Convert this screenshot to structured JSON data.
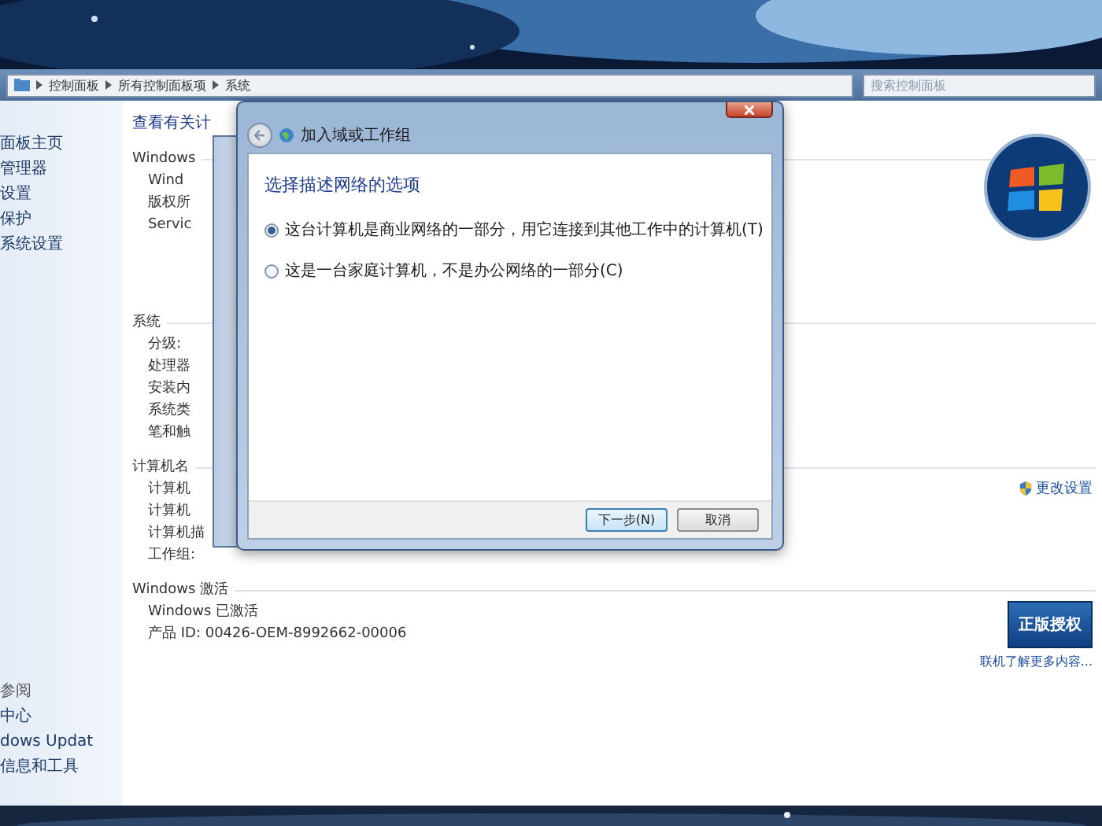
{
  "address_bar": {
    "breadcrumb": [
      "控制面板",
      "所有控制面板项",
      "系统"
    ],
    "search": {
      "placeholder": "搜索控制面板"
    }
  },
  "sidebar": {
    "links": [
      "面板主页",
      "管理器",
      "设置",
      "保护",
      "系统设置"
    ],
    "see_also": [
      "参阅",
      "中心",
      "dows Updat",
      "信息和工具"
    ]
  },
  "content": {
    "title": "查看有关计",
    "sections": [
      {
        "heading": "Windows",
        "rows": [
          "Wind",
          "版权所",
          "Servic"
        ],
        "kind": "logo"
      },
      {
        "heading": "系统",
        "rows": [
          "分级:",
          "处理器",
          "安装内",
          "系统类",
          "笔和触"
        ]
      },
      {
        "heading": "计算机名",
        "rows": [
          "计算机",
          "计算机",
          "计算机描",
          "工作组:"
        ],
        "kind": "settings"
      },
      {
        "heading": "Windows 激活",
        "rows": [
          "Windows 已激活",
          "产品 ID: 00426-OEM-8992662-00006"
        ],
        "kind": "activation"
      }
    ],
    "change_settings": "更改设置",
    "activation": {
      "badge": "正版授权",
      "link": "联机了解更多内容..."
    }
  },
  "dialog": {
    "title": "加入域或工作组",
    "heading": "选择描述网络的选项",
    "options": [
      {
        "label": "这台计算机是商业网络的一部分，用它连接到其他工作中的计算机(T)",
        "selected": true
      },
      {
        "label": "这是一台家庭计算机，不是办公网络的一部分(C)",
        "selected": false
      }
    ],
    "buttons": [
      {
        "label": "下一步(N)",
        "default": true
      },
      {
        "label": "取消",
        "default": false
      }
    ]
  }
}
